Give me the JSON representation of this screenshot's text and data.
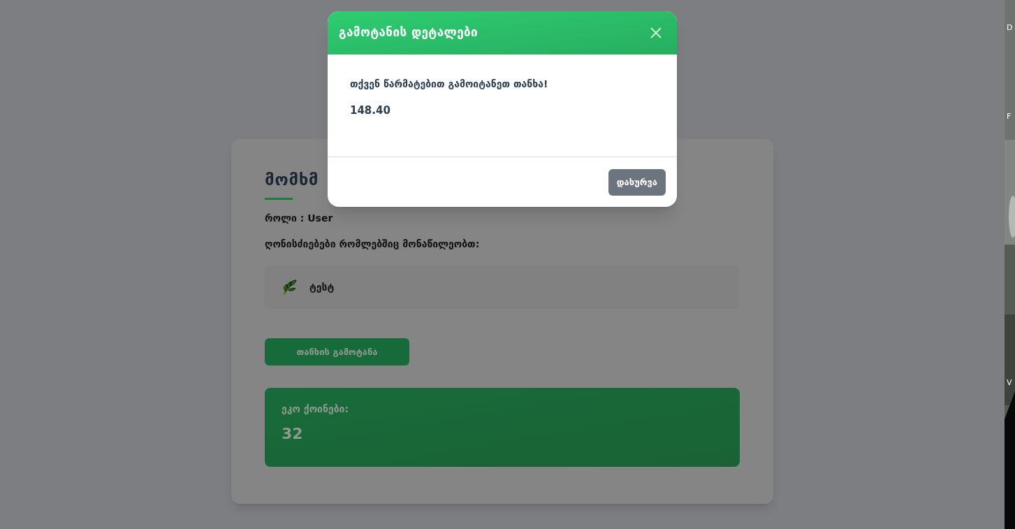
{
  "profile": {
    "heading": "მომხმ",
    "role": "როლი : User",
    "events_label": "ღონისძიებები რომლებშიც მონაწილეობთ:",
    "events": [
      {
        "name": "ტესტ"
      }
    ],
    "withdraw_button": "თანხის გამოტანა",
    "eco_coins": {
      "label": "ეკო ქოინები:",
      "value": "32"
    }
  },
  "modal": {
    "title": "გამოტანის დეტალები",
    "message": "თქვენ წარმატებით გამოიტანეთ თანხა!",
    "amount": "148.40",
    "close_button": "დახურვა"
  },
  "desktop_labels": [
    "D",
    "F",
    "V"
  ]
}
